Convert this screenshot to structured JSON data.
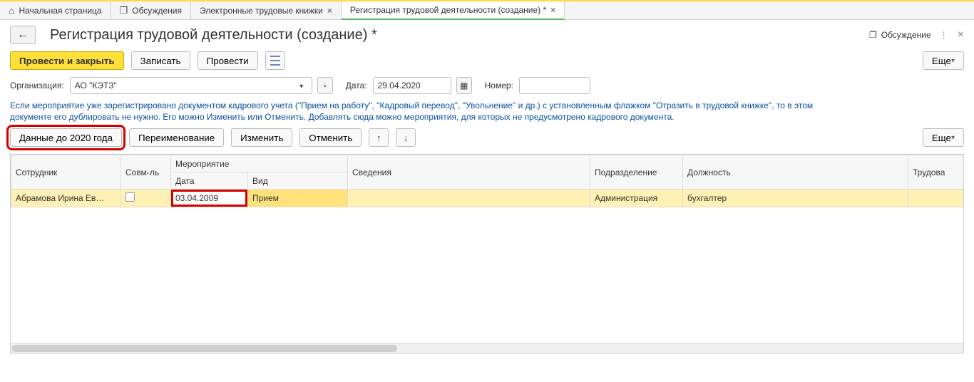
{
  "tabs": {
    "home": "Начальная страница",
    "discuss": "Обсуждения",
    "etk": "Электронные трудовые книжки",
    "doc": "Регистрация трудовой деятельности (создание) *"
  },
  "page_title": "Регистрация трудовой деятельности (создание) *",
  "title_actions": {
    "discuss": "Обсуждение"
  },
  "toolbar": {
    "apply_close": "Провести и закрыть",
    "save": "Записать",
    "apply": "Провести",
    "more": "Еще"
  },
  "form": {
    "org_label": "Организация:",
    "org_value": "АО \"КЭТЗ\"",
    "date_label": "Дата:",
    "date_value": "29.04.2020",
    "num_label": "Номер:",
    "num_value": ""
  },
  "info_text": "Если мероприятие уже зарегистрировано документом кадрового учета (\"Прием на работу\", \"Кадровый перевод\", \"Увольнение\" и др.) с установленным флажком \"Отразить в трудовой книжке\", то в этом документе его дублировать не нужно. Его можно Изменить или Отменить. Добавлять сюда можно мероприятия, для которых не предусмотрено кадрового документа.",
  "toolbar2": {
    "pre2020": "Данные до 2020 года",
    "rename": "Переименование",
    "edit": "Изменить",
    "cancel": "Отменить",
    "more": "Еще"
  },
  "grid": {
    "cols": {
      "employee": "Сотрудник",
      "sovm": "Совм-ль",
      "event": "Мероприятие",
      "date": "Дата",
      "vid": "Вид",
      "sved": "Сведения",
      "dept": "Подразделение",
      "position": "Должность",
      "trud": "Трудова"
    },
    "rows": [
      {
        "employee": "Абрамова Ирина Ев…",
        "sovm": false,
        "date": "03.04.2009",
        "vid": "Прием",
        "sved": "",
        "dept": "Администрация",
        "position": "бухгалтер",
        "trud": ""
      }
    ]
  }
}
